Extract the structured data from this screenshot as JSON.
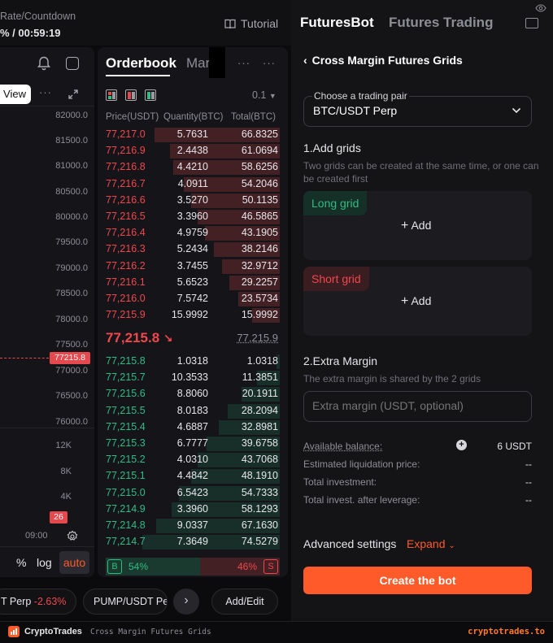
{
  "top": {
    "funding_label": "Rate/Countdown",
    "funding_value": "% / 00:59:19",
    "tutorial": "Tutorial"
  },
  "chart": {
    "view_label": "View",
    "more": "···",
    "price_ticks": [
      "82000.0",
      "81500.0",
      "81000.0",
      "80500.0",
      "80000.0",
      "79500.0",
      "79000.0",
      "78500.0",
      "78000.0",
      "77500.0",
      "77000.0",
      "76500.0",
      "76000.0"
    ],
    "current_tag": "77215.8",
    "vol_ticks": [
      "12K",
      "8K",
      "4K"
    ],
    "vol_tag": "26",
    "time_label": "09:00",
    "pct": "%",
    "log": "log",
    "auto": "auto"
  },
  "orderbook": {
    "tab_active": "Orderbook",
    "tab_other": "Mark",
    "more": "···",
    "precision": "0.1",
    "headers": {
      "price": "Price(USDT)",
      "qty": "Quantity(BTC)",
      "total": "Total(BTC)"
    },
    "asks": [
      {
        "price": "77,217.0",
        "qty": "5.7631",
        "total": "66.8325",
        "depth": 0.72
      },
      {
        "price": "77,216.9",
        "qty": "2.4438",
        "total": "61.0694",
        "depth": 0.63
      },
      {
        "price": "77,216.8",
        "qty": "4.4210",
        "total": "58.6256",
        "depth": 0.61
      },
      {
        "price": "77,216.7",
        "qty": "4.0911",
        "total": "54.2046",
        "depth": 0.55
      },
      {
        "price": "77,216.6",
        "qty": "3.5270",
        "total": "50.1135",
        "depth": 0.51
      },
      {
        "price": "77,216.5",
        "qty": "3.3960",
        "total": "46.5865",
        "depth": 0.47
      },
      {
        "price": "77,216.4",
        "qty": "4.9759",
        "total": "43.1905",
        "depth": 0.43
      },
      {
        "price": "77,216.3",
        "qty": "5.2434",
        "total": "38.2146",
        "depth": 0.38
      },
      {
        "price": "77,216.2",
        "qty": "3.7455",
        "total": "32.9712",
        "depth": 0.33
      },
      {
        "price": "77,216.1",
        "qty": "5.6523",
        "total": "29.2257",
        "depth": 0.29
      },
      {
        "price": "77,216.0",
        "qty": "7.5742",
        "total": "23.5734",
        "depth": 0.24
      },
      {
        "price": "77,215.9",
        "qty": "15.9992",
        "total": "15.9992",
        "depth": 0.16
      }
    ],
    "last_price": "77,215.8",
    "last_arrow": "↘",
    "mark_price": "77,215.9",
    "bids": [
      {
        "price": "77,215.8",
        "qty": "1.0318",
        "total": "1.0318",
        "depth": 0.02
      },
      {
        "price": "77,215.7",
        "qty": "10.3533",
        "total": "11.3851",
        "depth": 0.13
      },
      {
        "price": "77,215.6",
        "qty": "8.8060",
        "total": "20.1911",
        "depth": 0.22
      },
      {
        "price": "77,215.5",
        "qty": "8.0183",
        "total": "28.2094",
        "depth": 0.3
      },
      {
        "price": "77,215.4",
        "qty": "4.6887",
        "total": "32.8981",
        "depth": 0.35
      },
      {
        "price": "77,215.3",
        "qty": "6.7777",
        "total": "39.6758",
        "depth": 0.42
      },
      {
        "price": "77,215.2",
        "qty": "4.0310",
        "total": "43.7068",
        "depth": 0.47
      },
      {
        "price": "77,215.1",
        "qty": "4.4842",
        "total": "48.1910",
        "depth": 0.51
      },
      {
        "price": "77,215.0",
        "qty": "6.5423",
        "total": "54.7333",
        "depth": 0.58
      },
      {
        "price": "77,214.9",
        "qty": "3.3960",
        "total": "58.1293",
        "depth": 0.62
      },
      {
        "price": "77,214.8",
        "qty": "9.0337",
        "total": "67.1630",
        "depth": 0.71
      },
      {
        "price": "77,214.7",
        "qty": "7.3649",
        "total": "74.5279",
        "depth": 0.79
      }
    ],
    "buy_label": "B",
    "buy_pct": "54%",
    "buy_ratio": 0.54,
    "sell_pct": "46%",
    "sell_label": "S"
  },
  "ticker": {
    "item1_name": "T Perp",
    "item1_change": "-2.63%",
    "item2_name": "PUMP/USDT Pe",
    "add_edit": "Add/Edit"
  },
  "panel": {
    "tab_active": "FuturesBot",
    "tab_other": "Futures Trading",
    "back_title": "Cross Margin Futures Grids",
    "pair_label": "Choose a trading pair",
    "pair_value": "BTC/USDT Perp",
    "section1_title": "1.Add grids",
    "section1_desc": "Two grids can be created at the same time, or one can be created first",
    "long_grid": "Long grid",
    "short_grid": "Short grid",
    "add_label": "Add",
    "section2_title": "2.Extra Margin",
    "section2_desc": "The extra margin is shared by the 2 grids",
    "margin_placeholder": "Extra margin (USDT, optional)",
    "available_label": "Available balance:",
    "available_value": "6 USDT",
    "liq_label": "Estimated liquidation price:",
    "liq_value": "--",
    "invest_label": "Total investment:",
    "invest_value": "--",
    "lev_label": "Total invest. after leverage:",
    "lev_value": "--",
    "advanced_label": "Advanced settings",
    "expand_label": "Expand",
    "create_label": "Create the bot"
  },
  "footer": {
    "brand": "CryptoTrades",
    "subtitle": "Cross Margin Futures Grids",
    "site": "cryptotrades.to"
  },
  "colors": {
    "ask": "#f0474d",
    "bid": "#2ebd85",
    "accent": "#ff5a2a"
  }
}
